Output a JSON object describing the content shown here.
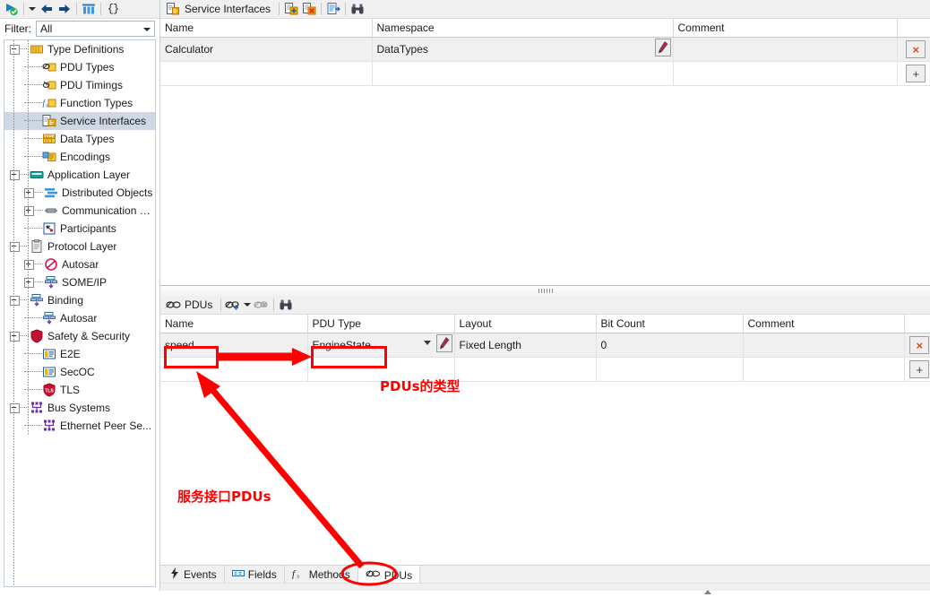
{
  "left_pane": {
    "toolbar": {
      "items": [
        {
          "name": "run-validate-icon",
          "glyph": "play-check"
        },
        {
          "name": "dropdown-caret-icon",
          "glyph": "caret-down"
        },
        {
          "name": "back-arrow-icon",
          "glyph": "arrow-left"
        },
        {
          "name": "forward-arrow-icon",
          "glyph": "arrow-right"
        },
        {
          "name": "columns-icon",
          "glyph": "columns"
        },
        {
          "name": "braces-icon",
          "glyph": "{}"
        }
      ]
    },
    "filter": {
      "label": "Filter:",
      "value": "All",
      "placeholder": "All"
    },
    "tree": [
      {
        "label": "Type Definitions",
        "depth": 0,
        "expander": "minus",
        "icon": "type-definitions-icon",
        "selected": false
      },
      {
        "label": "PDU Types",
        "depth": 1,
        "expander": "none",
        "icon": "pdu-types-icon",
        "selected": false
      },
      {
        "label": "PDU Timings",
        "depth": 1,
        "expander": "none",
        "icon": "pdu-timings-icon",
        "selected": false
      },
      {
        "label": "Function Types",
        "depth": 1,
        "expander": "none",
        "icon": "function-types-icon",
        "selected": false
      },
      {
        "label": "Service Interfaces",
        "depth": 1,
        "expander": "none",
        "icon": "service-interfaces-icon",
        "selected": true
      },
      {
        "label": "Data Types",
        "depth": 1,
        "expander": "none",
        "icon": "data-types-icon",
        "selected": false
      },
      {
        "label": "Encodings",
        "depth": 1,
        "expander": "none",
        "icon": "encodings-icon",
        "selected": false
      },
      {
        "label": "Application Layer",
        "depth": 0,
        "expander": "minus",
        "icon": "application-layer-icon",
        "selected": false
      },
      {
        "label": "Distributed Objects",
        "depth": 1,
        "expander": "plus",
        "icon": "distributed-objects-icon",
        "selected": false
      },
      {
        "label": "Communication O...",
        "depth": 1,
        "expander": "plus",
        "icon": "communication-objects-icon",
        "selected": false
      },
      {
        "label": "Participants",
        "depth": 1,
        "expander": "none",
        "icon": "participants-icon",
        "selected": false
      },
      {
        "label": "Protocol Layer",
        "depth": 0,
        "expander": "minus",
        "icon": "protocol-layer-icon",
        "selected": false
      },
      {
        "label": "Autosar",
        "depth": 1,
        "expander": "plus",
        "icon": "autosar-icon",
        "selected": false
      },
      {
        "label": "SOME/IP",
        "depth": 1,
        "expander": "plus",
        "icon": "someip-icon",
        "selected": false
      },
      {
        "label": "Binding",
        "depth": 0,
        "expander": "minus",
        "icon": "binding-icon",
        "selected": false
      },
      {
        "label": "Autosar",
        "depth": 1,
        "expander": "none",
        "icon": "binding-autosar-icon",
        "selected": false
      },
      {
        "label": "Safety & Security",
        "depth": 0,
        "expander": "minus",
        "icon": "safety-security-icon",
        "selected": false
      },
      {
        "label": "E2E",
        "depth": 1,
        "expander": "none",
        "icon": "e2e-icon",
        "selected": false
      },
      {
        "label": "SecOC",
        "depth": 1,
        "expander": "none",
        "icon": "secoc-icon",
        "selected": false
      },
      {
        "label": "TLS",
        "depth": 1,
        "expander": "none",
        "icon": "tls-icon",
        "selected": false
      },
      {
        "label": "Bus Systems",
        "depth": 0,
        "expander": "minus",
        "icon": "bus-systems-icon",
        "selected": false
      },
      {
        "label": "Ethernet Peer Se...",
        "depth": 1,
        "expander": "none",
        "icon": "ethernet-peer-icon",
        "selected": false
      }
    ]
  },
  "upper_panel": {
    "title": "Service Interfaces",
    "toolbar_buttons": [
      {
        "name": "add-service-interface-button",
        "icon": "document-add-icon"
      },
      {
        "name": "delete-service-interface-button",
        "icon": "document-delete-icon"
      },
      {
        "name": "edit-service-interface-button",
        "icon": "document-edit-icon"
      },
      {
        "name": "find-button",
        "icon": "binoculars-icon"
      }
    ],
    "table": {
      "columns": [
        "Name",
        "Namespace",
        "Comment"
      ],
      "rows": [
        {
          "name": "Calculator",
          "namespace": "DataTypes",
          "comment": "",
          "edit_icon": "pencil-icon",
          "delete_label": "×"
        }
      ],
      "add_row_label": "+"
    }
  },
  "lower_panel": {
    "title": "PDUs",
    "toolbar_buttons": [
      {
        "name": "add-pdu-button",
        "icon": "pdu-add-icon"
      },
      {
        "name": "delete-pdu-button",
        "icon": "pdu-delete-icon"
      },
      {
        "name": "find-pdu-button",
        "icon": "binoculars-icon"
      }
    ],
    "table": {
      "columns": [
        "Name",
        "PDU Type",
        "Layout",
        "Bit Count",
        "Comment"
      ],
      "rows": [
        {
          "name": "speed",
          "pdu_type": "EngineState",
          "layout": "Fixed Length",
          "bit_count": "0",
          "comment": "",
          "edit_icon": "pencil-icon",
          "delete_label": "×"
        }
      ],
      "add_row_label": "+"
    },
    "tabs": [
      {
        "label": "Events",
        "icon": "lightning-icon",
        "active": false
      },
      {
        "label": "Fields",
        "icon": "field-icon",
        "active": false
      },
      {
        "label": "Methods",
        "icon": "fx-icon",
        "active": false
      },
      {
        "label": "PDUs",
        "icon": "pdu-icon",
        "active": true
      }
    ]
  },
  "annotations": {
    "color": "#ff0000",
    "labels": [
      {
        "name": "pdu-type-annotation",
        "text": "PDUs的类型"
      },
      {
        "name": "service-interface-pdus-annotation",
        "text": "服务接口PDUs"
      }
    ],
    "highlight_boxes": [
      {
        "name": "speed-cell-highlight"
      },
      {
        "name": "enginestate-cell-highlight"
      },
      {
        "name": "pdus-tab-highlight"
      }
    ]
  }
}
